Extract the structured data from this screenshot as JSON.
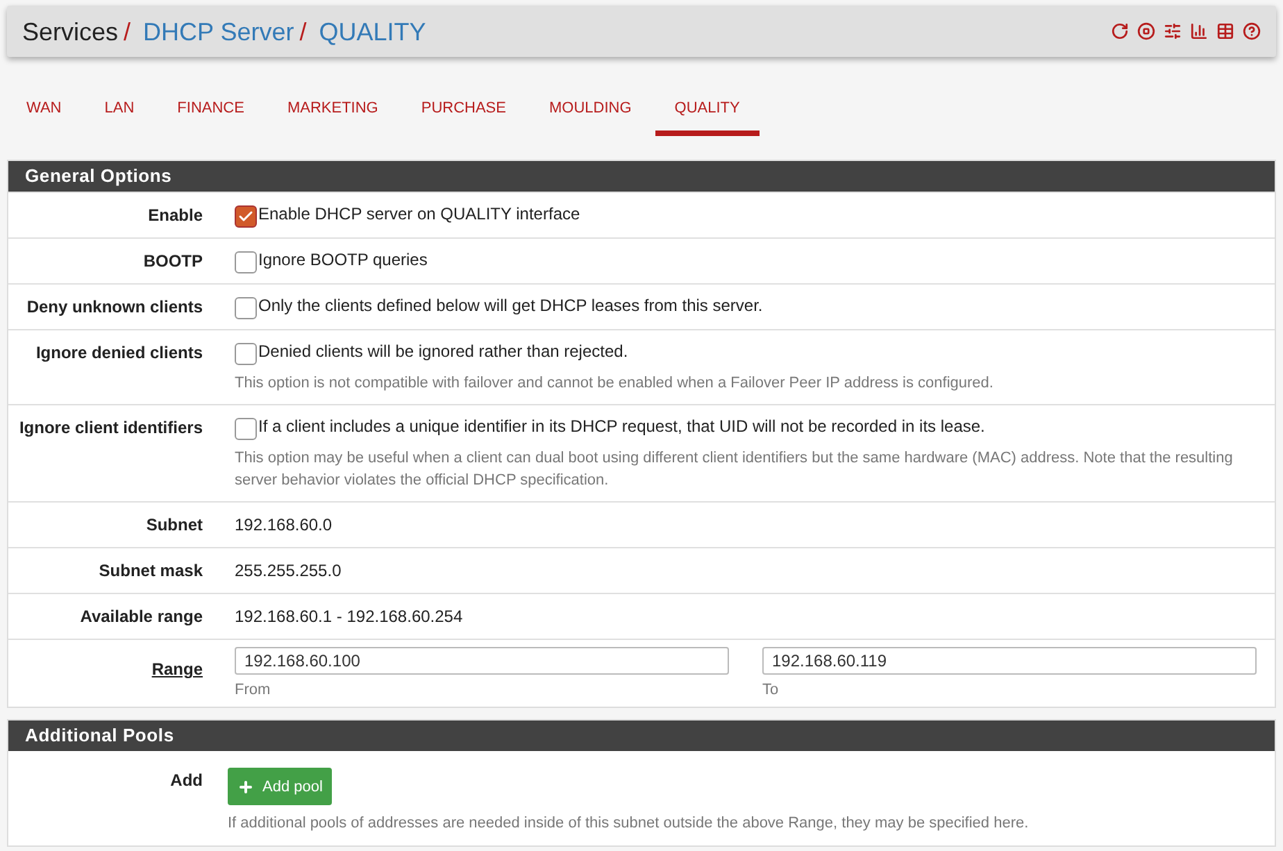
{
  "breadcrumb": [
    {
      "text": "Services",
      "link": false,
      "separator": "/"
    },
    {
      "text": "DHCP Server",
      "link": true,
      "separator": "/"
    },
    {
      "text": "QUALITY",
      "link": true
    }
  ],
  "tabs": [
    {
      "label": "WAN",
      "selected": false
    },
    {
      "label": "LAN",
      "selected": false
    },
    {
      "label": "FINANCE",
      "selected": false
    },
    {
      "label": "MARKETING",
      "selected": false
    },
    {
      "label": "PURCHASE",
      "selected": false
    },
    {
      "label": "MOULDING",
      "selected": false
    },
    {
      "label": "QUALITY",
      "selected": true
    }
  ],
  "general_options": {
    "title": "General Options",
    "rows": [
      {
        "kind": "checkbox",
        "label": "Enable",
        "checked": true,
        "text": "Enable DHCP server on QUALITY interface"
      },
      {
        "kind": "checkbox",
        "label": "BOOTP",
        "checked": false,
        "text": "Ignore BOOTP queries"
      },
      {
        "kind": "checkbox",
        "label": "Deny unknown clients",
        "checked": false,
        "text": "Only the clients defined below will get DHCP leases from this server."
      },
      {
        "kind": "checkbox",
        "label": "Ignore denied clients",
        "checked": false,
        "text": "Denied clients will be ignored rather than rejected.",
        "help": "This option is not compatible with failover and cannot be enabled when a Failover Peer IP address is configured."
      },
      {
        "kind": "checkbox",
        "label": "Ignore client identifiers",
        "checked": false,
        "text": "If a client includes a unique identifier in its DHCP request, that UID will not be recorded in its lease.",
        "help": "This option may be useful when a client can dual boot using different client identifiers but the same hardware (MAC) address. Note that the resulting server behavior violates the official DHCP specification."
      },
      {
        "kind": "static",
        "label": "Subnet",
        "value": "192.168.60.0"
      },
      {
        "kind": "static",
        "label": "Subnet mask",
        "value": "255.255.255.0"
      },
      {
        "kind": "static",
        "label": "Available range",
        "value": "192.168.60.1 - 192.168.60.254"
      },
      {
        "kind": "range",
        "label": "Range",
        "from": {
          "value": "192.168.60.100",
          "caption": "From"
        },
        "to": {
          "value": "192.168.60.119",
          "caption": "To"
        }
      }
    ]
  },
  "additional_pools": {
    "title": "Additional Pools",
    "label": "Add",
    "button": "Add pool",
    "help": "If additional pools of addresses are needed inside of this subnet outside the above Range, they may be specified here."
  }
}
